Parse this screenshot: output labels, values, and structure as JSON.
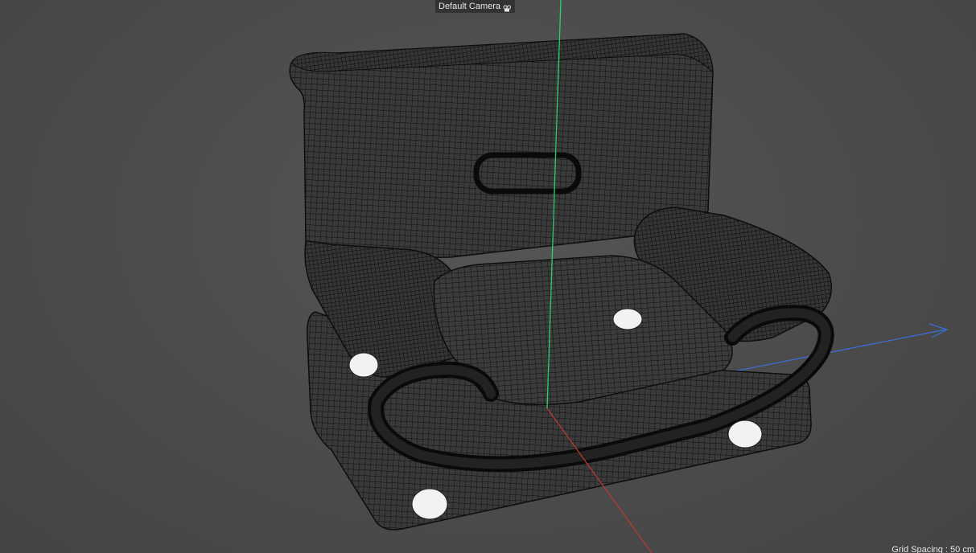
{
  "viewport": {
    "camera_label": "Default Camera",
    "camera_icon": "camera-icon",
    "grid_spacing_text": "Grid Spacing : 50 cm",
    "axis_colors": {
      "x": "#c0392b",
      "y": "#2ecc71",
      "z": "#3a6fd8"
    },
    "background_color": "#4d4d4d",
    "wire_color": "#111111"
  }
}
